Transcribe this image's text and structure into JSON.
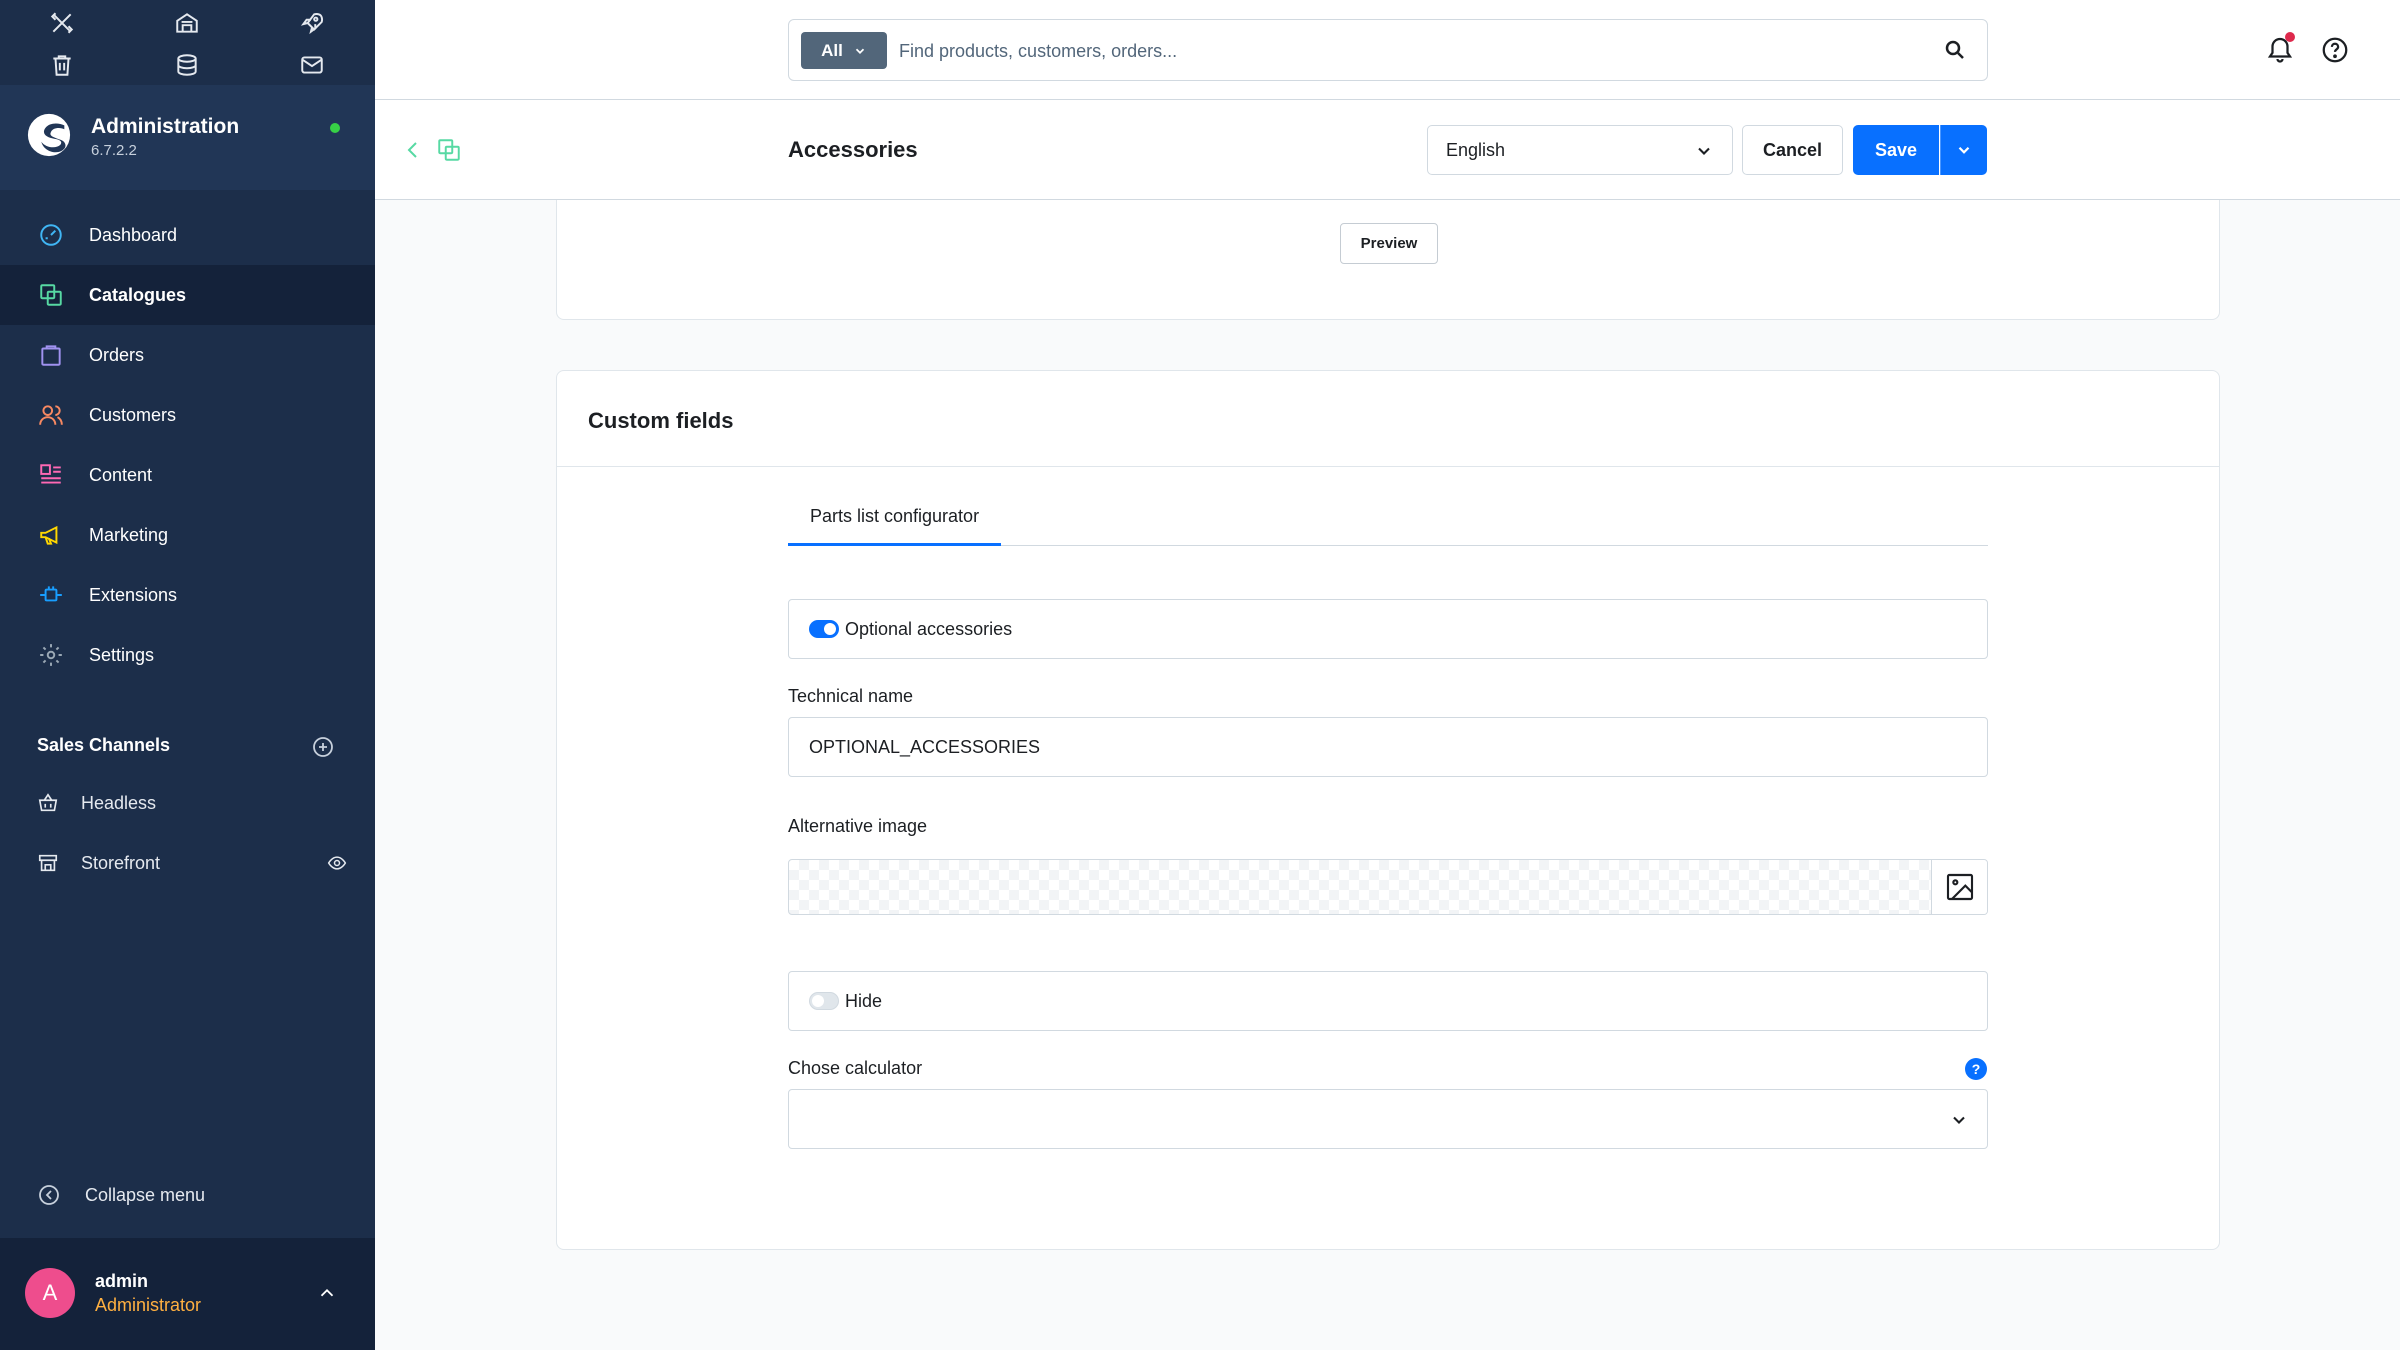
{
  "brand": {
    "title": "Administration",
    "version": "6.7.2.2",
    "status_color": "#37d046"
  },
  "quick_icons": [
    "tools-icon",
    "store-icon",
    "rocket-icon",
    "trash-icon",
    "database-icon",
    "envelope-icon"
  ],
  "nav": {
    "items": [
      {
        "label": "Dashboard",
        "icon": "gauge-icon",
        "color": "#40b6f5"
      },
      {
        "label": "Catalogues",
        "icon": "catalogue-icon",
        "color": "#57d9a3",
        "active": true
      },
      {
        "label": "Orders",
        "icon": "bag-icon",
        "color": "#a092f0"
      },
      {
        "label": "Customers",
        "icon": "users-icon",
        "color": "#f88962"
      },
      {
        "label": "Content",
        "icon": "content-icon",
        "color": "#ff68b4"
      },
      {
        "label": "Marketing",
        "icon": "megaphone-icon",
        "color": "#ffd700"
      },
      {
        "label": "Extensions",
        "icon": "plug-icon",
        "color": "#189eff"
      },
      {
        "label": "Settings",
        "icon": "gear-icon",
        "color": "#9aa8b5"
      }
    ]
  },
  "sales_channels": {
    "title": "Sales Channels",
    "items": [
      {
        "label": "Headless",
        "icon": "basket-icon"
      },
      {
        "label": "Storefront",
        "icon": "storefront-icon"
      }
    ]
  },
  "collapse_label": "Collapse menu",
  "user": {
    "initial": "A",
    "name": "admin",
    "role": "Administrator"
  },
  "search": {
    "type_label": "All",
    "placeholder": "Find products, customers, orders..."
  },
  "smartbar": {
    "title": "Accessories",
    "language": "English",
    "cancel_label": "Cancel",
    "save_label": "Save"
  },
  "preview_label": "Preview",
  "custom_fields": {
    "title": "Custom fields",
    "tab_label": "Parts list configurator",
    "optional_accessories": {
      "label": "Optional accessories",
      "checked": true
    },
    "technical_name": {
      "label": "Technical name",
      "value": "OPTIONAL_ACCESSORIES"
    },
    "alternative_image": {
      "label": "Alternative image"
    },
    "hide": {
      "label": "Hide",
      "checked": false
    },
    "calculator": {
      "label": "Chose calculator",
      "value": "",
      "help": "?"
    }
  },
  "colors": {
    "accent": "#0870ff",
    "sidebar_bg": "#1c2e4a",
    "role_color": "#ffb041"
  }
}
